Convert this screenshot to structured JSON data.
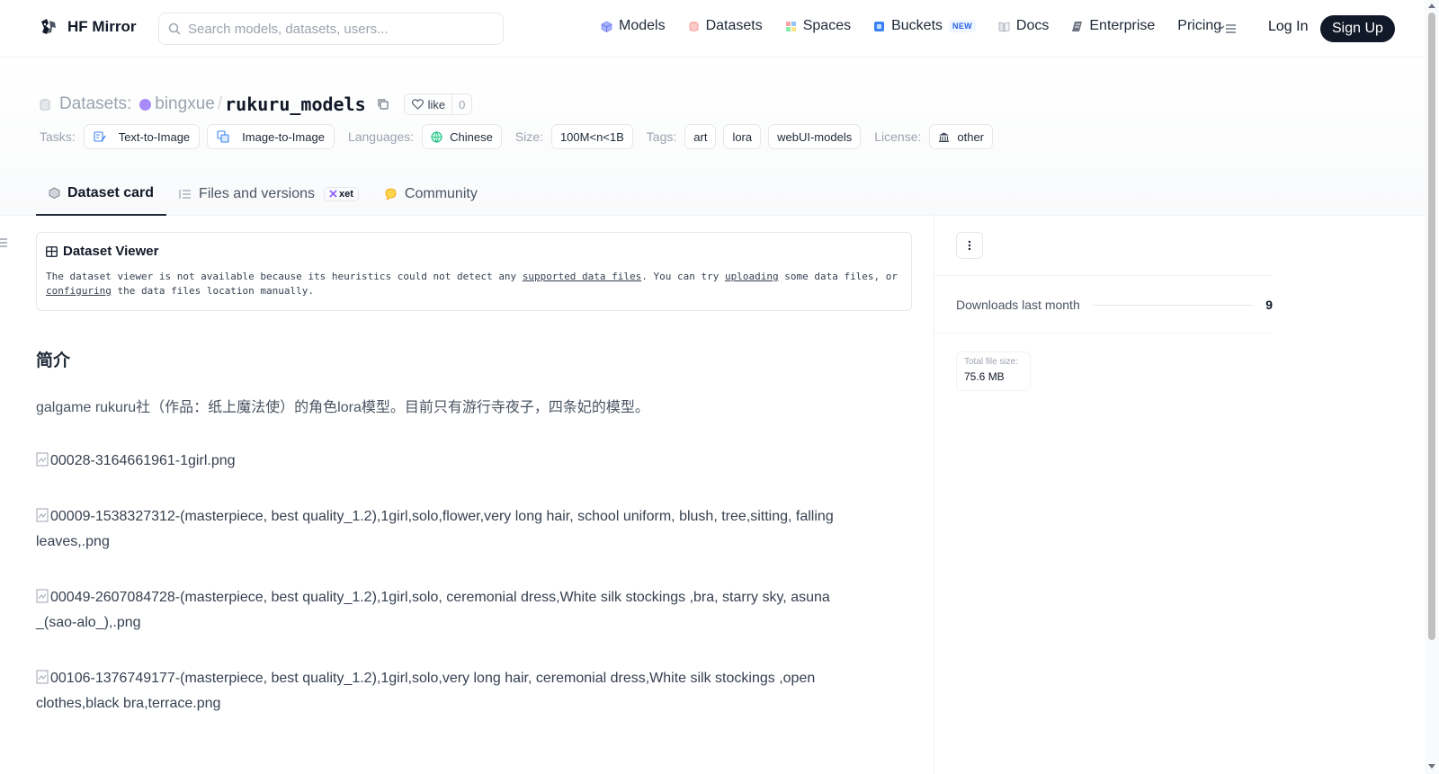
{
  "nav": {
    "brand": "HF Mirror",
    "search_placeholder": "Search models, datasets, users...",
    "links": {
      "models": "Models",
      "datasets": "Datasets",
      "spaces": "Spaces",
      "buckets": "Buckets",
      "buckets_badge": "NEW",
      "docs": "Docs",
      "enterprise": "Enterprise",
      "pricing": "Pricing"
    },
    "login": "Log In",
    "signup": "Sign Up"
  },
  "header": {
    "section_label": "Datasets:",
    "owner": "bingxue",
    "separator": "/",
    "repo": "rukuru_models",
    "like_label": "like",
    "like_count": "0",
    "tasks_label": "Tasks:",
    "tasks": [
      "Text-to-Image",
      "Image-to-Image"
    ],
    "languages_label": "Languages:",
    "language": "Chinese",
    "size_label": "Size:",
    "size": "100M<n<1B",
    "tags_label": "Tags:",
    "tags": [
      "art",
      "lora",
      "webUI-models"
    ],
    "license_label": "License:",
    "license": "other"
  },
  "tabs": {
    "dataset_card": "Dataset card",
    "files": "Files and versions",
    "xet": "xet",
    "community": "Community"
  },
  "viewer": {
    "title": "Dataset Viewer",
    "text_1": "The dataset viewer is not available because its heuristics could not detect any ",
    "link_1": "supported data files",
    "text_2": ". You can try ",
    "link_2": "uploading",
    "text_3": " some data files, or ",
    "link_3": "configuring",
    "text_4": " the data files location manually."
  },
  "content": {
    "heading": "简介",
    "intro": "galgame rukuru社（作品：纸上魔法使）的角色lora模型。目前只有游行寺夜子，四条妃的模型。",
    "images": [
      "00028-3164661961-1girl.png",
      "00009-1538327312-(masterpiece, best quality_1.2),1girl,solo,flower,very long hair, school uniform, blush, tree,sitting, falling leaves,.png",
      "00049-2607084728-(masterpiece, best quality_1.2),1girl,solo, ceremonial dress,White silk stockings ,bra, starry sky, asuna _(sao-alo_),.png",
      "00106-1376749177-(masterpiece, best quality_1.2),1girl,solo,very long hair, ceremonial dress,White silk stockings ,open clothes,black bra,terrace.png"
    ]
  },
  "sidebar": {
    "downloads_label": "Downloads last month",
    "downloads_value": "9",
    "total_size_label": "Total file size:",
    "total_size_value": "75.6 MB"
  },
  "colors": {
    "accent": "#111827",
    "avatar": "#a78bfa",
    "badge_new": "#2563eb",
    "border": "#e5e7eb"
  },
  "icons": [
    "hf-logo-icon",
    "search-icon",
    "models-icon",
    "datasets-icon",
    "spaces-icon",
    "buckets-icon",
    "docs-icon",
    "enterprise-icon",
    "menu-icon",
    "copy-icon",
    "heart-icon",
    "text-to-image-icon",
    "image-to-image-icon",
    "globe-icon",
    "license-icon",
    "files-icon",
    "xet-icon",
    "community-icon",
    "table-icon",
    "kebab-icon",
    "broken-image-icon"
  ]
}
